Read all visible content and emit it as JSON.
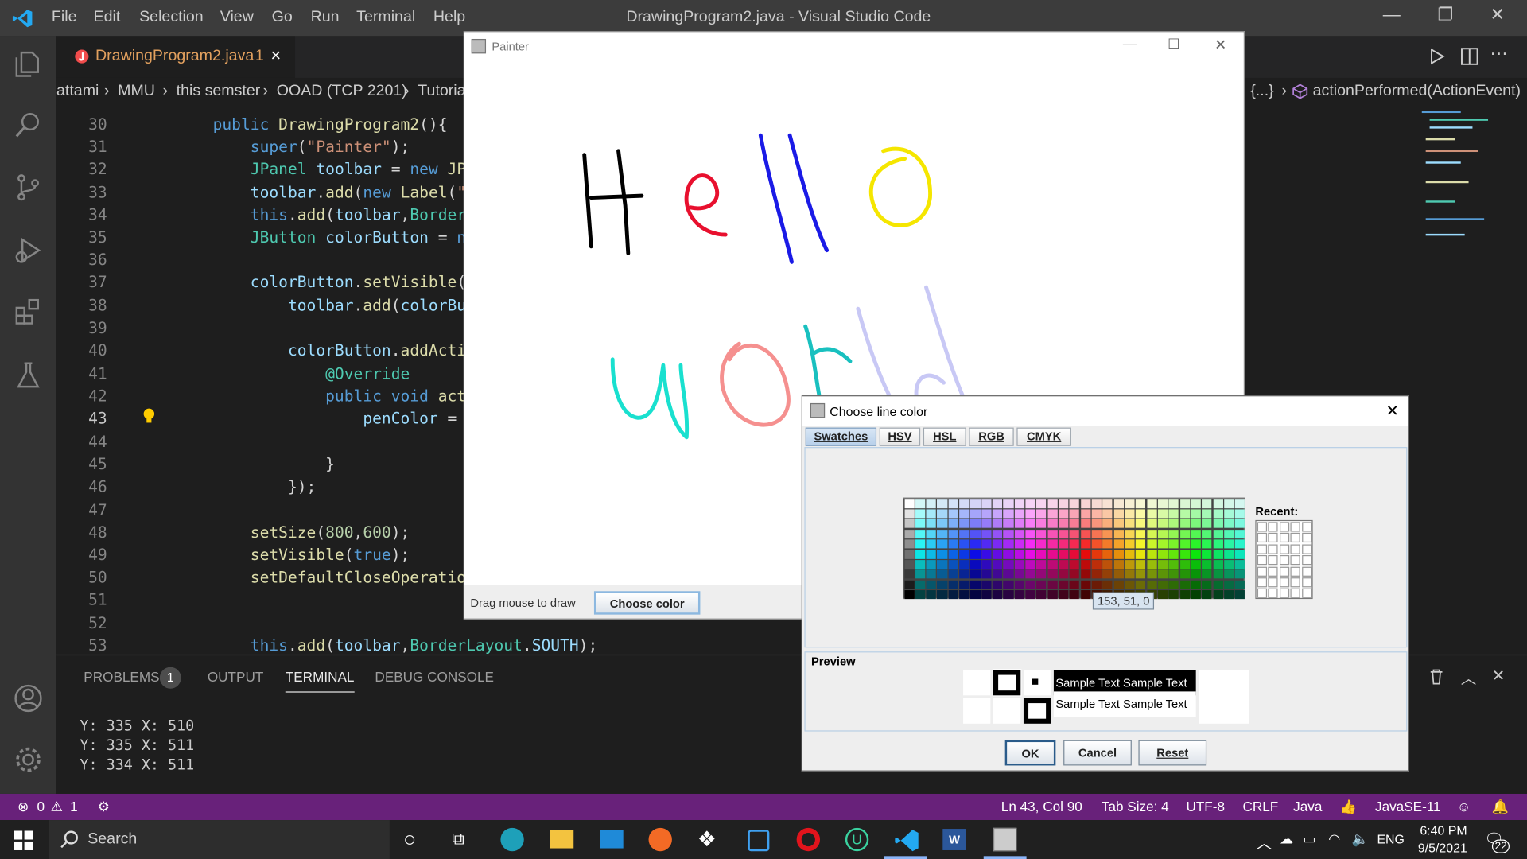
{
  "vscode": {
    "menu": [
      "File",
      "Edit",
      "Selection",
      "View",
      "Go",
      "Run",
      "Terminal",
      "Help"
    ],
    "window_title": "DrawingProgram2.java - Visual Studio Code",
    "tab": {
      "label": "DrawingProgram2.java",
      "badge": "1",
      "close": "×"
    },
    "breadcrumbs": [
      "attami",
      "MMU",
      "this semster",
      "OOAD (TCP 2201)",
      "Tutoria"
    ],
    "breadcrumb_tail": "{...}",
    "breadcrumb_method": "actionPerformed(ActionEvent)",
    "line_numbers": [
      "30",
      "31",
      "32",
      "33",
      "34",
      "35",
      "36",
      "37",
      "38",
      "39",
      "40",
      "41",
      "42",
      "43",
      "44",
      "45",
      "46",
      "47",
      "48",
      "49",
      "50",
      "51",
      "52",
      "53"
    ],
    "panel_tabs": [
      "PROBLEMS",
      "OUTPUT",
      "TERMINAL",
      "DEBUG CONSOLE"
    ],
    "problems_count": "1",
    "terminal_lines": [
      "Y: 335 X: 510",
      "Y: 335 X: 511",
      "Y: 334 X: 511"
    ],
    "status": {
      "errors": "0",
      "warnings": "1",
      "position": "Ln 43, Col 90",
      "tab_size": "Tab Size: 4",
      "encoding": "UTF-8",
      "eol": "CRLF",
      "language": "Java",
      "runtime": "JavaSE-11"
    }
  },
  "painter": {
    "title": "Painter",
    "hint": "Drag mouse to draw",
    "button": "Choose color",
    "drawn_words": [
      "Hello",
      "world"
    ]
  },
  "dialog": {
    "title": "Choose line color",
    "tabs": [
      "Swatches",
      "HSV",
      "HSL",
      "RGB",
      "CMYK"
    ],
    "recent_label": "Recent:",
    "tooltip": "153, 51, 0",
    "preview_label": "Preview",
    "sample_text": "Sample Text",
    "buttons": {
      "ok": "OK",
      "cancel": "Cancel",
      "reset": "Reset"
    }
  },
  "taskbar": {
    "search": "Search",
    "time": "6:40 PM",
    "date": "9/5/2021",
    "lang": "ENG",
    "notifications": "22"
  }
}
